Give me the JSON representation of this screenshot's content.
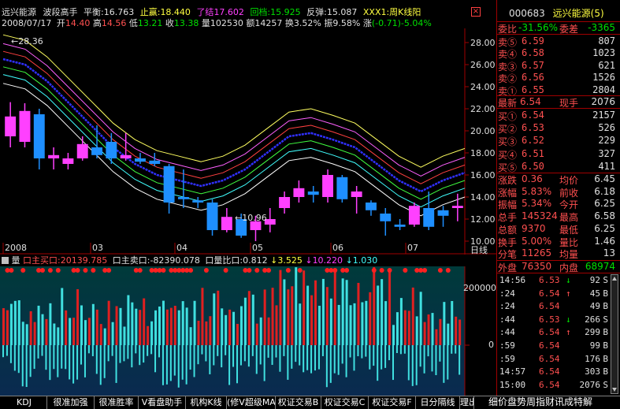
{
  "header": {
    "stock_name": "远兴能源",
    "indicator_name": "波段高手",
    "balance_label": "平衡:",
    "balance_value": "16.763",
    "stop_label": "止赢:",
    "stop_value": "18.440",
    "close_label": "了结",
    "close_value": "17.602",
    "pullback_label": "回档:",
    "pullback_value": "15.925",
    "rebound_label": "反弹:",
    "rebound_value": "15.087",
    "extra_text": "XXX1:周K线阳",
    "date": "2008/07/17",
    "open_label": "开",
    "open_value": "14.40",
    "high_label": "高",
    "high_value": "14.56",
    "low_label": "低",
    "low_value": "13.21",
    "close2_label": "收",
    "close2_value": "13.38",
    "volume_label": "量",
    "volume_value": "102530",
    "amount_label": "额",
    "amount_value": "14257",
    "turnover_label": "换",
    "turnover_value": "3.52%",
    "amplitude_label": "振",
    "amplitude_value": "9.58%",
    "change_label": "涨",
    "change_value": "(-0.71)-5.04%"
  },
  "chart": {
    "y_ticks": [
      "28.00",
      "26.00",
      "24.00",
      "22.00",
      "20.00",
      "18.00",
      "16.00",
      "14.00",
      "12.00",
      "10.00"
    ],
    "x_ticks": [
      "2008",
      "03",
      "04",
      "05",
      "06",
      "07"
    ],
    "period_label": "日线",
    "max_marker": "28.36",
    "min_marker": "10.96"
  },
  "volume_header": {
    "toggle_label": "量",
    "main_buy_label": "口主买口:",
    "main_buy_value": "20139.785",
    "main_sell_label": "口主卖口:",
    "main_sell_value": "-82390.078",
    "ratio_label": "口量比口:",
    "ratio_value": "0.812",
    "v1": "3.525",
    "v2": "10.220",
    "v3": "1.030"
  },
  "volume_axis": {
    "top": "200000",
    "zero": "0"
  },
  "chart_data": {
    "type": "candlestick",
    "y_range": [
      9,
      29
    ],
    "candles": [
      {
        "o": 19.5,
        "c": 21.3,
        "h": 22.6,
        "l": 18.5
      },
      {
        "o": 19.0,
        "c": 21.8,
        "h": 22.5,
        "l": 18.5
      },
      {
        "o": 21.5,
        "c": 17.5,
        "h": 22.0,
        "l": 16.5
      },
      {
        "o": 17.5,
        "c": 17.8,
        "h": 18.5,
        "l": 16.5
      },
      {
        "o": 17.0,
        "c": 17.5,
        "h": 18.0,
        "l": 16.5
      },
      {
        "o": 17.5,
        "c": 18.8,
        "h": 19.5,
        "l": 17.3
      },
      {
        "o": 18.5,
        "c": 17.8,
        "h": 20.5,
        "l": 17.5
      },
      {
        "o": 19.0,
        "c": 17.5,
        "h": 19.8,
        "l": 17.0
      },
      {
        "o": 17.5,
        "c": 17.8,
        "h": 19.8,
        "l": 17.3
      },
      {
        "o": 17.5,
        "c": 17.2,
        "h": 18.0,
        "l": 17.0
      },
      {
        "o": 17.3,
        "c": 17.0,
        "h": 18.0,
        "l": 16.8
      },
      {
        "o": 16.8,
        "c": 13.5,
        "h": 17.0,
        "l": 12.5
      },
      {
        "o": 14.0,
        "c": 13.8,
        "h": 16.5,
        "l": 13.0
      },
      {
        "o": 13.7,
        "c": 13.5,
        "h": 14.0,
        "l": 13.0
      },
      {
        "o": 13.5,
        "c": 11.0,
        "h": 13.8,
        "l": 10.5
      },
      {
        "o": 11.0,
        "c": 12.2,
        "h": 13.0,
        "l": 10.8
      },
      {
        "o": 12.0,
        "c": 10.5,
        "h": 12.5,
        "l": 10.3
      },
      {
        "o": 11.0,
        "c": 11.8,
        "h": 12.3,
        "l": 10.0
      },
      {
        "o": 11.5,
        "c": 12.0,
        "h": 13.0,
        "l": 10.8
      },
      {
        "o": 13.0,
        "c": 14.0,
        "h": 14.5,
        "l": 12.5
      },
      {
        "o": 14.0,
        "c": 14.8,
        "h": 15.5,
        "l": 13.5
      },
      {
        "o": 14.5,
        "c": 14.2,
        "h": 15.0,
        "l": 13.5
      },
      {
        "o": 14.0,
        "c": 16.0,
        "h": 16.5,
        "l": 13.5
      },
      {
        "o": 15.8,
        "c": 13.8,
        "h": 16.0,
        "l": 13.5
      },
      {
        "o": 14.0,
        "c": 14.5,
        "h": 15.0,
        "l": 12.5
      },
      {
        "o": 13.5,
        "c": 12.8,
        "h": 13.7,
        "l": 12.3
      },
      {
        "o": 12.5,
        "c": 11.8,
        "h": 13.0,
        "l": 10.5
      },
      {
        "o": 11.5,
        "c": 11.3,
        "h": 12.0,
        "l": 11.0
      },
      {
        "o": 11.5,
        "c": 13.2,
        "h": 13.5,
        "l": 11.3
      },
      {
        "o": 13.0,
        "c": 11.3,
        "h": 14.5,
        "l": 11.0
      },
      {
        "o": 12.8,
        "c": 12.3,
        "h": 13.2,
        "l": 11.3
      },
      {
        "o": 13.0,
        "c": 13.2,
        "h": 14.3,
        "l": 11.8
      }
    ]
  },
  "quote": {
    "code": "000683",
    "name": "远兴能源",
    "suffix": "(5)",
    "weibi_label": "委比",
    "weibi_value": "-31.56%",
    "weicha_label": "委差",
    "weicha_value": "-3365",
    "sell": [
      {
        "label": "卖⑤",
        "price": "6.59",
        "vol": "807"
      },
      {
        "label": "卖④",
        "price": "6.58",
        "vol": "1023"
      },
      {
        "label": "卖③",
        "price": "6.57",
        "vol": "621"
      },
      {
        "label": "卖②",
        "price": "6.56",
        "vol": "1526"
      },
      {
        "label": "卖①",
        "price": "6.55",
        "vol": "2804"
      }
    ],
    "last_label": "最新",
    "last_value": "6.54",
    "cur_vol_label": "现手",
    "cur_vol_value": "2076",
    "buy": [
      {
        "label": "买①",
        "price": "6.54",
        "vol": "2157"
      },
      {
        "label": "买②",
        "price": "6.53",
        "vol": "526"
      },
      {
        "label": "买③",
        "price": "6.52",
        "vol": "229"
      },
      {
        "label": "买④",
        "price": "6.51",
        "vol": "327"
      },
      {
        "label": "买⑤",
        "price": "6.50",
        "vol": "411"
      }
    ],
    "stats": [
      {
        "l1": "涨跌",
        "v1": "0.36",
        "l2": "均价",
        "v2": "6.45"
      },
      {
        "l1": "涨幅",
        "v1": "5.83%",
        "l2": "前收",
        "v2": "6.18"
      },
      {
        "l1": "振幅",
        "v1": "5.34%",
        "l2": "今开",
        "v2": "6.25"
      },
      {
        "l1": "总手",
        "v1": "145324",
        "l2": "最高",
        "v2": "6.58"
      },
      {
        "l1": "总额",
        "v1": "9370",
        "l2": "最低",
        "v2": "6.25"
      },
      {
        "l1": "换手",
        "v1": "5.00%",
        "l2": "量比",
        "v2": "1.46"
      },
      {
        "l1": "分笔",
        "v1": "11265",
        "l2": "均量",
        "v2": "13"
      }
    ],
    "outer_label": "外盘",
    "outer_value": "76350",
    "inner_label": "内盘",
    "inner_value": "68974"
  },
  "ticks": [
    {
      "time": "14:56",
      "price": "6.53",
      "arrow": "↓",
      "vol": "92",
      "bs": "S"
    },
    {
      "time": ":24",
      "price": "6.54",
      "arrow": "↑",
      "vol": "45",
      "bs": "B"
    },
    {
      "time": ":24",
      "price": "6.54",
      "arrow": "",
      "vol": "49",
      "bs": "B"
    },
    {
      "time": ":44",
      "price": "6.53",
      "arrow": "↓",
      "vol": "266",
      "bs": "S"
    },
    {
      "time": ":44",
      "price": "6.54",
      "arrow": "↑",
      "vol": "299",
      "bs": "B"
    },
    {
      "time": ":59",
      "price": "6.54",
      "arrow": "",
      "vol": "99",
      "bs": "B"
    },
    {
      "time": ":59",
      "price": "6.54",
      "arrow": "",
      "vol": "176",
      "bs": "B"
    },
    {
      "time": "14:57",
      "price": "6.54",
      "arrow": "",
      "vol": "303",
      "bs": "B"
    },
    {
      "time": "15:00",
      "price": "6.54",
      "arrow": "",
      "vol": "2076",
      "bs": "S"
    }
  ],
  "tabs": [
    "KDJ",
    "很准加强",
    "很准胜率",
    "V看盘助手",
    "机构K线",
    "(修V超级MACD",
    "权证交易B",
    "权证交易C",
    "权证交易F",
    "日分隔线",
    "理出"
  ],
  "side_tabs": "细价盘势周指财讯成特解",
  "colors": {
    "up": "#ff40ff",
    "down": "#1e8fff",
    "bg": "#000000"
  }
}
